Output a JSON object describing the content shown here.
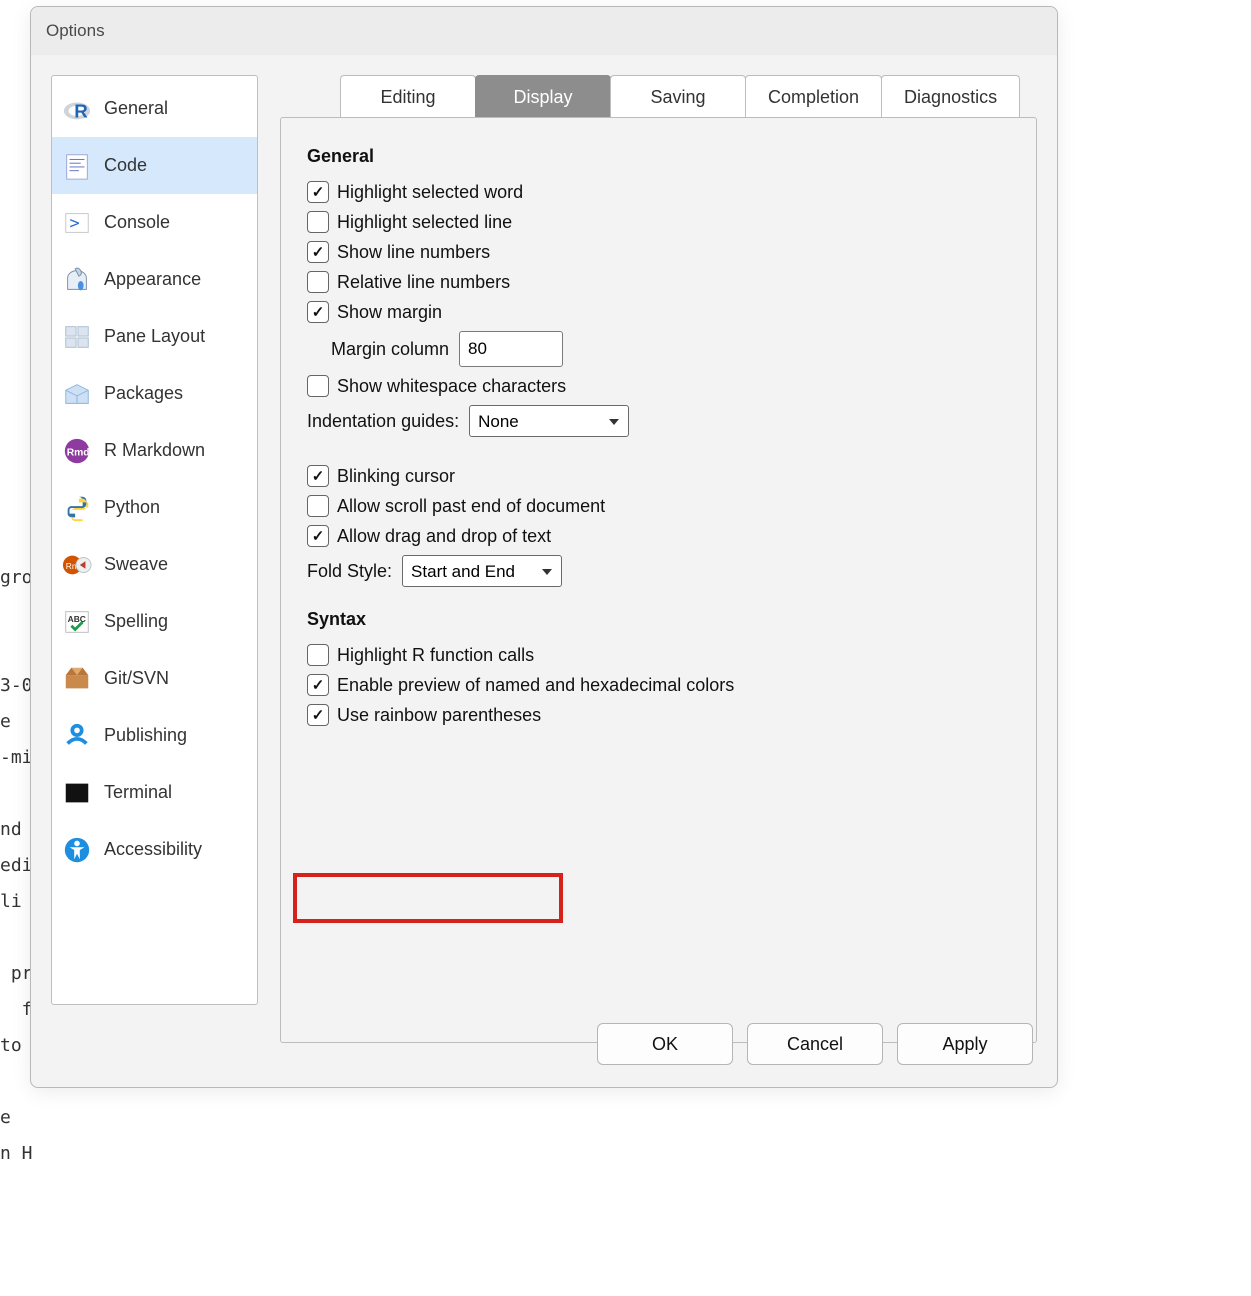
{
  "bg_text": "gro\n\n\n3-0\ne\n-mi\n\nnd\nedi\nli\n\n pr\n  f\nto\n\ne\nn H",
  "dialog": {
    "title": "Options"
  },
  "sidebar": {
    "items": [
      {
        "label": "General"
      },
      {
        "label": "Code"
      },
      {
        "label": "Console"
      },
      {
        "label": "Appearance"
      },
      {
        "label": "Pane Layout"
      },
      {
        "label": "Packages"
      },
      {
        "label": "R Markdown"
      },
      {
        "label": "Python"
      },
      {
        "label": "Sweave"
      },
      {
        "label": "Spelling"
      },
      {
        "label": "Git/SVN"
      },
      {
        "label": "Publishing"
      },
      {
        "label": "Terminal"
      },
      {
        "label": "Accessibility"
      }
    ],
    "selected": "Code"
  },
  "tabs": {
    "items": [
      {
        "label": "Editing"
      },
      {
        "label": "Display"
      },
      {
        "label": "Saving"
      },
      {
        "label": "Completion"
      },
      {
        "label": "Diagnostics"
      }
    ],
    "active": "Display"
  },
  "sections": {
    "general": {
      "heading": "General",
      "highlight_selected_word": {
        "label": "Highlight selected word",
        "checked": true
      },
      "highlight_selected_line": {
        "label": "Highlight selected line",
        "checked": false
      },
      "show_line_numbers": {
        "label": "Show line numbers",
        "checked": true
      },
      "relative_line_numbers": {
        "label": "Relative line numbers",
        "checked": false
      },
      "show_margin": {
        "label": "Show margin",
        "checked": true
      },
      "margin_column": {
        "label": "Margin column",
        "value": "80"
      },
      "show_whitespace": {
        "label": "Show whitespace characters",
        "checked": false
      },
      "indent_guides": {
        "label": "Indentation guides:",
        "value": "None"
      },
      "blinking_cursor": {
        "label": "Blinking cursor",
        "checked": true
      },
      "scroll_past_end": {
        "label": "Allow scroll past end of document",
        "checked": false
      },
      "drag_drop": {
        "label": "Allow drag and drop of text",
        "checked": true
      },
      "fold_style": {
        "label": "Fold Style:",
        "value": "Start and End"
      }
    },
    "syntax": {
      "heading": "Syntax",
      "highlight_r_calls": {
        "label": "Highlight R function calls",
        "checked": false
      },
      "preview_colors": {
        "label": "Enable preview of named and hexadecimal colors",
        "checked": true
      },
      "rainbow_parens": {
        "label": "Use rainbow parentheses",
        "checked": true
      }
    }
  },
  "buttons": {
    "ok": "OK",
    "cancel": "Cancel",
    "apply": "Apply"
  }
}
